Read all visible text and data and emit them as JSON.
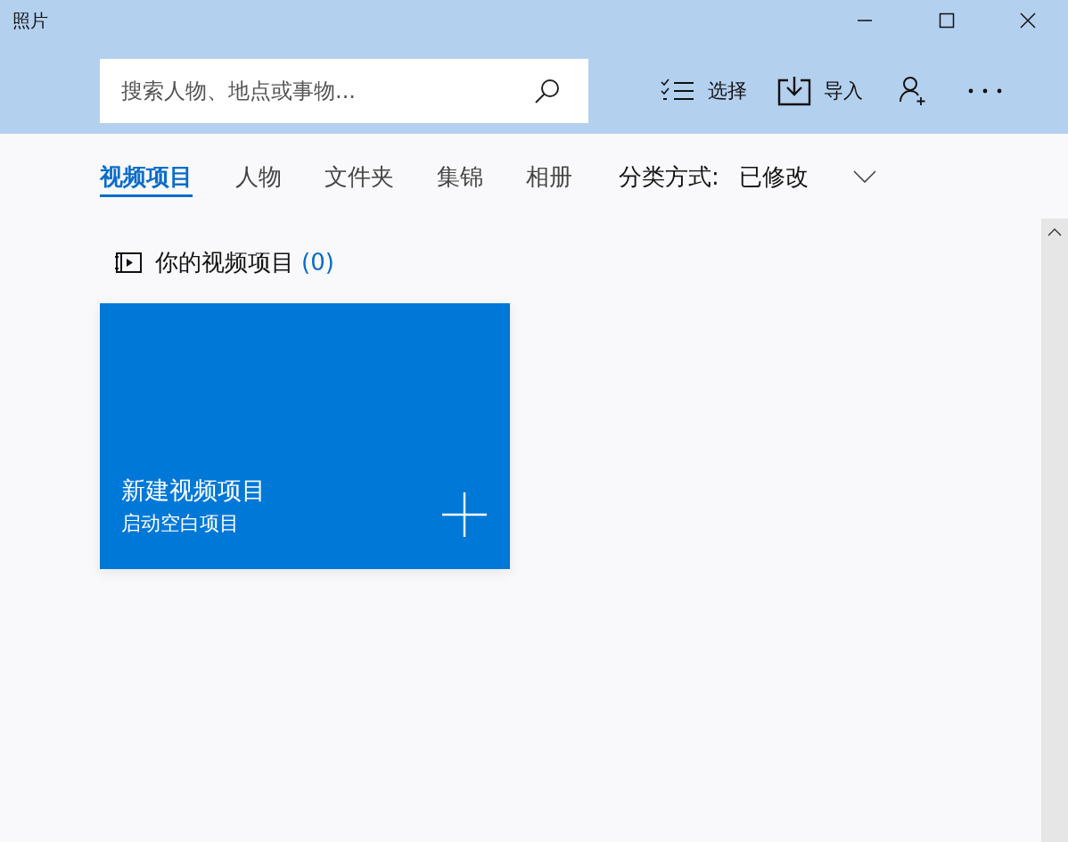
{
  "window": {
    "title": "照片"
  },
  "search": {
    "placeholder": "搜索人物、地点或事物..."
  },
  "toolbar": [
    {
      "kind": "select",
      "label": "选择"
    },
    {
      "kind": "import",
      "label": "导入"
    },
    {
      "kind": "account"
    },
    {
      "kind": "more"
    }
  ],
  "tabs": [
    {
      "label": "视频项目",
      "selected": true
    },
    {
      "label": "人物",
      "selected": false
    },
    {
      "label": "文件夹",
      "selected": false
    },
    {
      "label": "集锦",
      "selected": false
    },
    {
      "label": "相册",
      "selected": false
    }
  ],
  "sort": {
    "label": "分类方式:",
    "value": "已修改"
  },
  "section": {
    "title": "你的视频项目",
    "count": "(0)"
  },
  "new_project_card": {
    "title": "新建视频项目",
    "subtitle": "启动空白项目"
  }
}
